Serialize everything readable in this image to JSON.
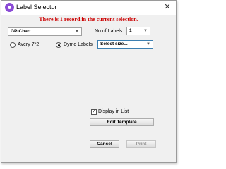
{
  "window": {
    "title": "Label Selector",
    "icon": "label-app-icon",
    "close_glyph": "✕"
  },
  "notice": "There is 1 record in the current selection.",
  "template_select": {
    "value": "GP-Chart"
  },
  "num_labels": {
    "label": "No of Labels",
    "value": "1"
  },
  "label_type": {
    "options": [
      "Avery 7*2",
      "Dymo Labels"
    ],
    "selected": "Dymo Labels"
  },
  "size_select": {
    "value": "Select size..."
  },
  "display_in_list": {
    "label": "Display in List",
    "checked": true
  },
  "buttons": {
    "edit_template": "Edit Template",
    "cancel": "Cancel",
    "print": "Print"
  },
  "colors": {
    "notice": "#cc0000",
    "app_icon": "#8b4bd6"
  }
}
